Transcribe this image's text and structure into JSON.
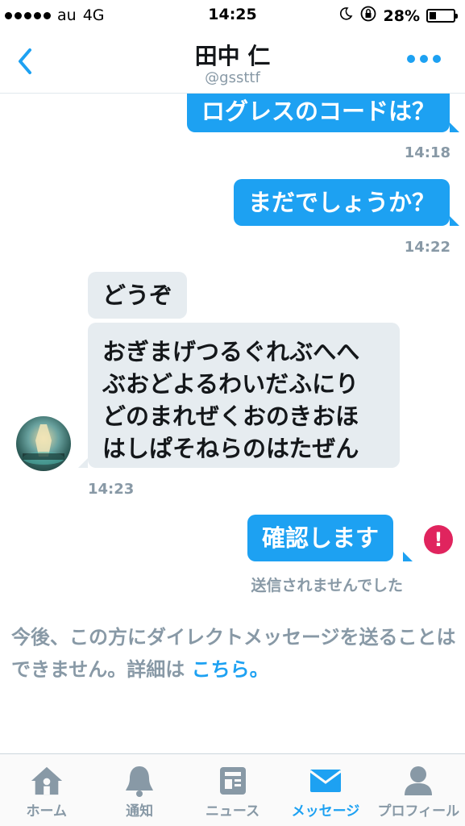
{
  "status_bar": {
    "carrier": "au",
    "network": "4G",
    "time": "14:25",
    "battery_percent_text": "28%",
    "battery_level": 0.28
  },
  "header": {
    "title": "田中 仁",
    "handle": "@gssttf"
  },
  "messages": [
    {
      "direction": "out",
      "text": "ログレスのコードは？",
      "time": "14:18"
    },
    {
      "direction": "out",
      "text": "まだでしょうか？",
      "time": "14:22"
    },
    {
      "direction": "in",
      "text": "どうぞ"
    },
    {
      "direction": "in",
      "lines": [
        "おぎまげつるぐれぶへへ",
        "ぶおどよるわいだふにり",
        "どのまれぜくおのきおほ",
        "はしぱそねらのはたぜん"
      ],
      "time": "14:23"
    },
    {
      "direction": "out",
      "text": "確認します",
      "status": "送信されませんでした"
    }
  ],
  "notice": {
    "text": "今後、この方にダイレクトメッセージを送ることはできません。詳細は ",
    "link": "こちら。"
  },
  "tabs": [
    {
      "label": "ホーム",
      "icon": "home-icon",
      "active": false
    },
    {
      "label": "通知",
      "icon": "bell-icon",
      "active": false
    },
    {
      "label": "ニュース",
      "icon": "news-icon",
      "active": false
    },
    {
      "label": "メッセージ",
      "icon": "envelope-icon",
      "active": true
    },
    {
      "label": "プロフィール",
      "icon": "person-icon",
      "active": false
    }
  ],
  "colors": {
    "accent": "#1da1f2",
    "error": "#e0245e",
    "incoming_bubble": "#e6ecf0",
    "muted_text": "#8899a6"
  }
}
